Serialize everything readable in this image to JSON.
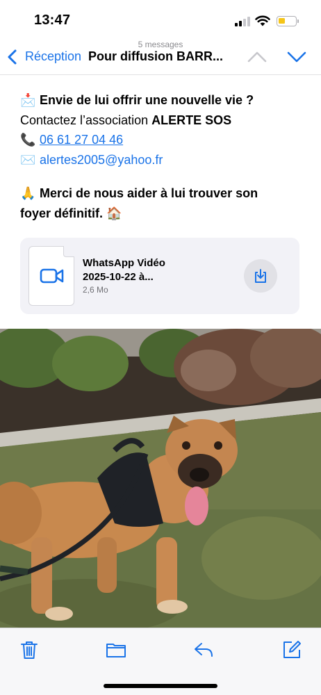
{
  "status_bar": {
    "time": "13:47",
    "battery_color": "#f5c518"
  },
  "nav": {
    "message_count": "5 messages",
    "back_label": "Réception",
    "title": "Pour diffusion BARR...",
    "accent": "#1a73e8"
  },
  "body": {
    "line1_text": "Envie de lui offrir une nouvelle vie ?",
    "line2_prefix": "Contactez l’association",
    "line2_bold": "ALERTE SOS",
    "phone": "06 61 27 04 46",
    "email": "alertes2005@yahoo.fr",
    "line5_text": "Merci de nous aider à lui trouver son",
    "line6_text": "foyer définitif.",
    "emojis": {
      "envelope_in": "📩",
      "phone": "📞",
      "envelope": "✉️",
      "pray": "🙏",
      "house": "🏠"
    }
  },
  "attachment": {
    "name_line1": "WhatsApp Vidéo",
    "name_line2": "2025-10-22 à...",
    "size": "2,6 Mo",
    "icon": "video-camera-icon"
  },
  "photo": {
    "subject": "dog-photo"
  },
  "toolbar": {
    "icons": [
      "trash-icon",
      "folder-icon",
      "reply-icon",
      "compose-icon"
    ]
  }
}
